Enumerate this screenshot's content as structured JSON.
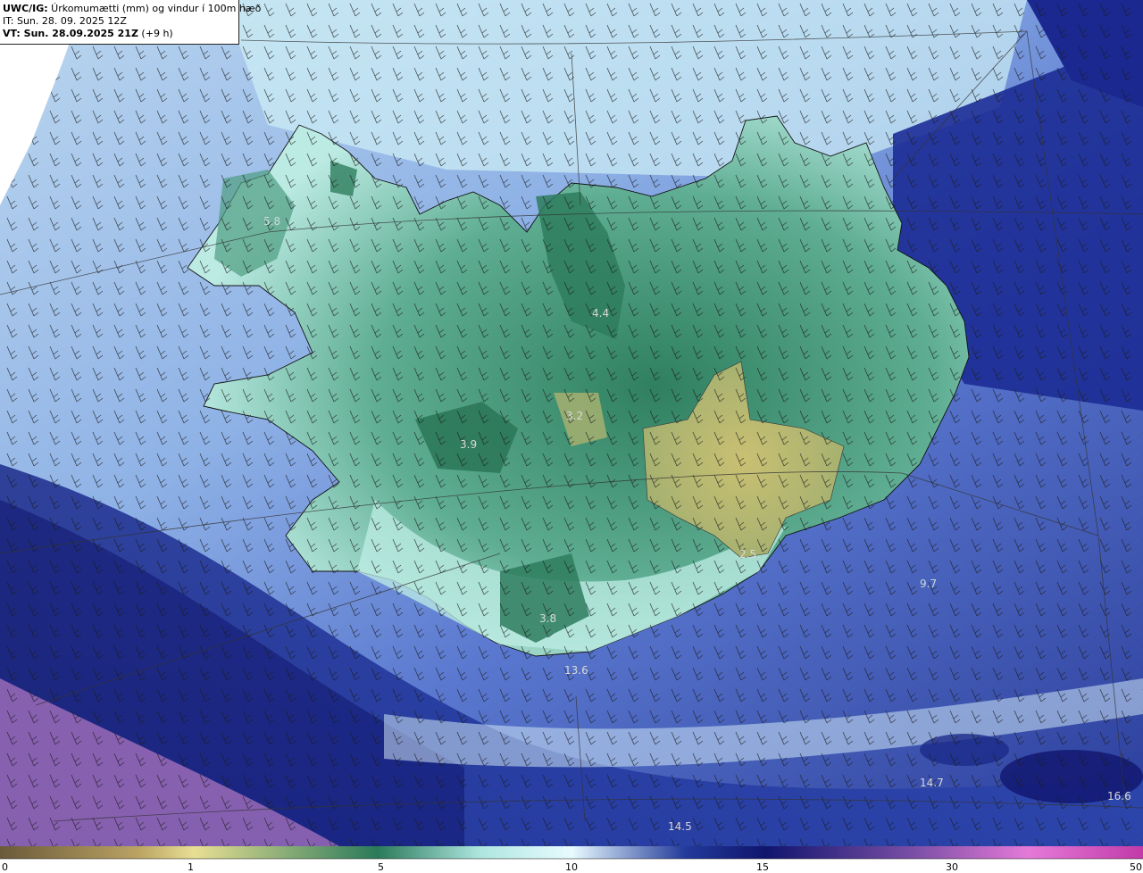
{
  "header": {
    "title_bold": "UWC/IG:",
    "title_rest": " Úrkomumætti (mm) og vindur í 100m hæð",
    "it_line": "IT: Sun. 28. 09. 2025 12Z",
    "vt_bold": "VT: Sun. 28.09.2025 21Z",
    "vt_rest": " (+9 h)"
  },
  "map_labels": [
    {
      "text": "5.8"
    },
    {
      "text": "4.4"
    },
    {
      "text": "3.2"
    },
    {
      "text": "3.9"
    },
    {
      "text": "2.5"
    },
    {
      "text": "3.8"
    },
    {
      "text": "13.6"
    },
    {
      "text": "9.7"
    },
    {
      "text": "14.7"
    },
    {
      "text": "14.5"
    },
    {
      "text": "16.6"
    }
  ],
  "colorbar": {
    "ticks": [
      "0",
      "1",
      "5",
      "10",
      "15",
      "30",
      "50"
    ],
    "colors": [
      "#6b5a3a",
      "#b9a262",
      "#e8df93",
      "#2a7a5a",
      "#aee6df",
      "#e8fbff",
      "#223a9a",
      "#10156e",
      "#7b4fa6",
      "#e57ad8",
      "#c23aa8"
    ]
  },
  "colors": {
    "land_dark": "#2e7d5e",
    "land_green": "#5aa88a",
    "highland_tan": "#b9b36a",
    "coast_light": "#bfeee6",
    "sea_blue": "#4a66c4",
    "sea_navy": "#11206f",
    "purple": "#9a6bb8"
  }
}
